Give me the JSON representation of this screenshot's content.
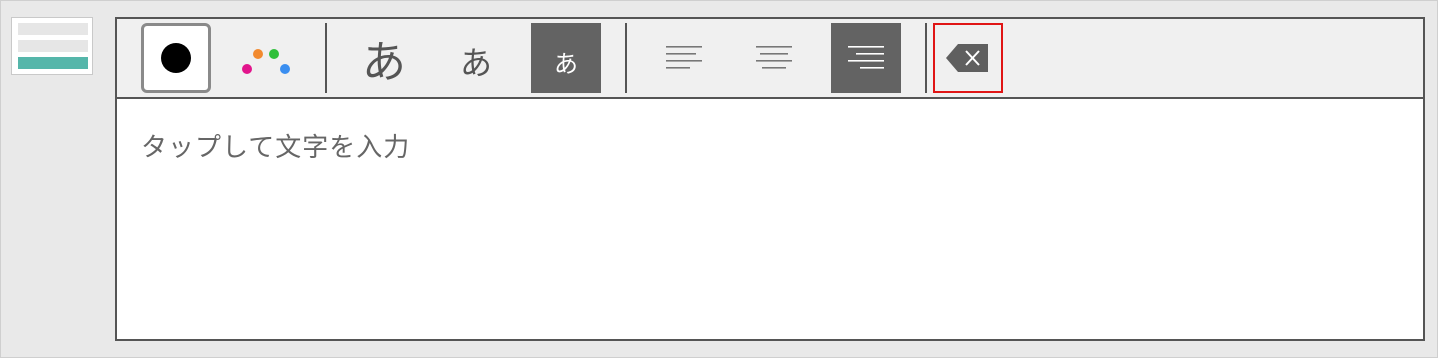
{
  "thumbnail": {
    "icon": "text-layout-thumbnail-icon",
    "accent_color": "#55b6aa"
  },
  "toolbar": {
    "colors": [
      {
        "name": "black",
        "hex": "#000000",
        "selected": true
      },
      {
        "name": "multicolor",
        "dots": [
          "#f28a2f",
          "#2fbf3a",
          "#e2158c",
          "#3a8ef0"
        ],
        "selected": false
      }
    ],
    "sizes": [
      {
        "name": "large",
        "label": "あ",
        "selected": false
      },
      {
        "name": "medium",
        "label": "あ",
        "selected": false
      },
      {
        "name": "small",
        "label": "あ",
        "selected": true
      }
    ],
    "alignments": [
      {
        "name": "left",
        "icon": "align-left-icon",
        "selected": false
      },
      {
        "name": "center",
        "icon": "align-center-icon",
        "selected": false
      },
      {
        "name": "right",
        "icon": "align-right-icon",
        "selected": true
      }
    ],
    "clear": {
      "icon": "backspace-icon",
      "highlighted": true,
      "highlight_color": "#e01515"
    }
  },
  "editor": {
    "placeholder": "タップして文字を入力"
  },
  "colors": {
    "selected_bg": "#636363",
    "border": "#555555",
    "toolbar_bg": "#f0f0f0"
  }
}
